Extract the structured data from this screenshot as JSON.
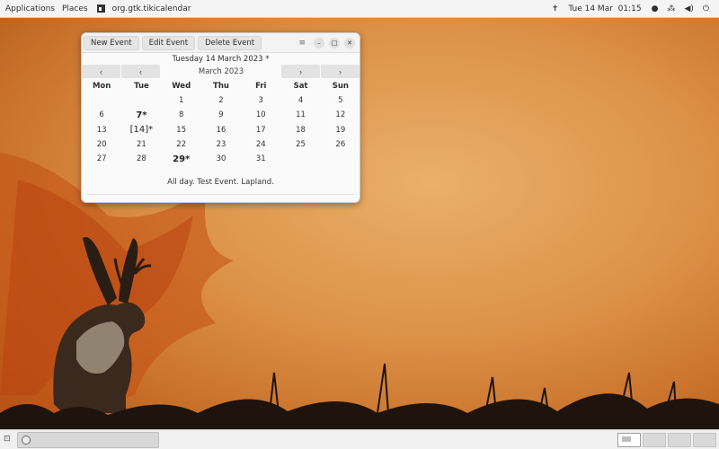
{
  "topbar": {
    "applications": "Applications",
    "places": "Places",
    "app_name": "org.gtk.tikicalendar",
    "datetime": "Tue 14 Mar  01:15"
  },
  "window": {
    "buttons": {
      "new_event": "New Event",
      "edit_event": "Edit Event",
      "delete_event": "Delete Event"
    },
    "date_heading": "Tuesday 14 March 2023 *",
    "month_label": "March 2023",
    "weekdays": [
      "Mon",
      "Tue",
      "Wed",
      "Thu",
      "Fri",
      "Sat",
      "Sun"
    ],
    "weeks": [
      [
        "",
        "",
        "1",
        "2",
        "3",
        "4",
        "5"
      ],
      [
        "6",
        "7*",
        "8",
        "9",
        "10",
        "11",
        "12"
      ],
      [
        "13",
        "[14]*",
        "15",
        "16",
        "17",
        "18",
        "19"
      ],
      [
        "20",
        "21",
        "22",
        "23",
        "24",
        "25",
        "26"
      ],
      [
        "27",
        "28",
        "29*",
        "30",
        "31",
        "",
        ""
      ]
    ],
    "event_text": "All day. Test Event. Lapland."
  },
  "icons": {
    "nav_prev_year": "chevron-left-icon",
    "nav_prev_month": "chevron-left-icon",
    "nav_next_month": "chevron-right-icon",
    "nav_next_year": "chevron-right-icon"
  },
  "colors": {
    "wallpaper_light": "#eab06a",
    "wallpaper_dark": "#a85518",
    "window_bg": "#fafafa",
    "button_bg": "#e5e5e5"
  }
}
